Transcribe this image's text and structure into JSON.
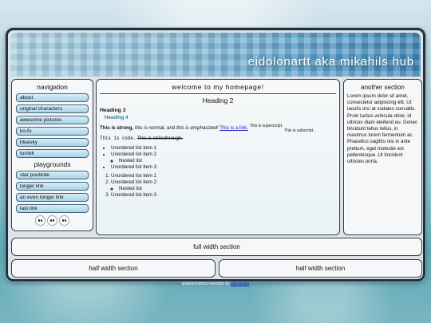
{
  "header": {
    "title": "eidolonartt aka mikahils hub"
  },
  "nav": {
    "heading": "navigation",
    "items": [
      {
        "label": "about"
      },
      {
        "label": "original characters"
      },
      {
        "label": "awesome pictures"
      },
      {
        "label": "ko-fo"
      },
      {
        "label": "bluesky"
      },
      {
        "label": "tumblr"
      }
    ],
    "playgrounds_heading": "playgrounds",
    "playgrounds": [
      {
        "label": "star poolside"
      },
      {
        "label": "longer link"
      },
      {
        "label": "an even longer link"
      },
      {
        "label": "last link"
      }
    ]
  },
  "main": {
    "welcome": "welcome to my homepage!",
    "heading2": "Heading 2",
    "heading3": "Heading 3",
    "heading4": "Heading 4",
    "p_strong": "This is strong,",
    "p_normal": " this is normal, and ",
    "p_em": "this is emphasized!",
    "p_link": "This is a link.",
    "p_sup": "This is superscript.",
    "p_sub": "This is subscript.",
    "code": "This is code.",
    "strike": "This is strikethrough.",
    "ul": [
      "Unordered list item 1",
      "Unordered list item 2",
      "Nested list",
      "Unordered list item 3"
    ],
    "ol": [
      "Unordered list item 1",
      "Unordered list item 2",
      "Nested list",
      "Unordered list item 3"
    ]
  },
  "side": {
    "heading": "another section",
    "text": "Lorem ipsum dolor sit amet, consectetur adipiscing elit. Ut iaculis orci at sodales convallis. Proin luctus vehicula dolor, id ultrices diam eleifend eu. Donec tincidunt tellus tellus, in maximus lorem fermentum ac. Phasellus sagittis nisi in ante pretium, eget molestie est pellentesque. Ut tincidunt ultricies porta."
  },
  "full_section": "full width section",
  "half_left": "half width section",
  "half_right": "half width section",
  "footer": {
    "text": "sparklecharms.neocities by ",
    "link": "sitecreator"
  }
}
